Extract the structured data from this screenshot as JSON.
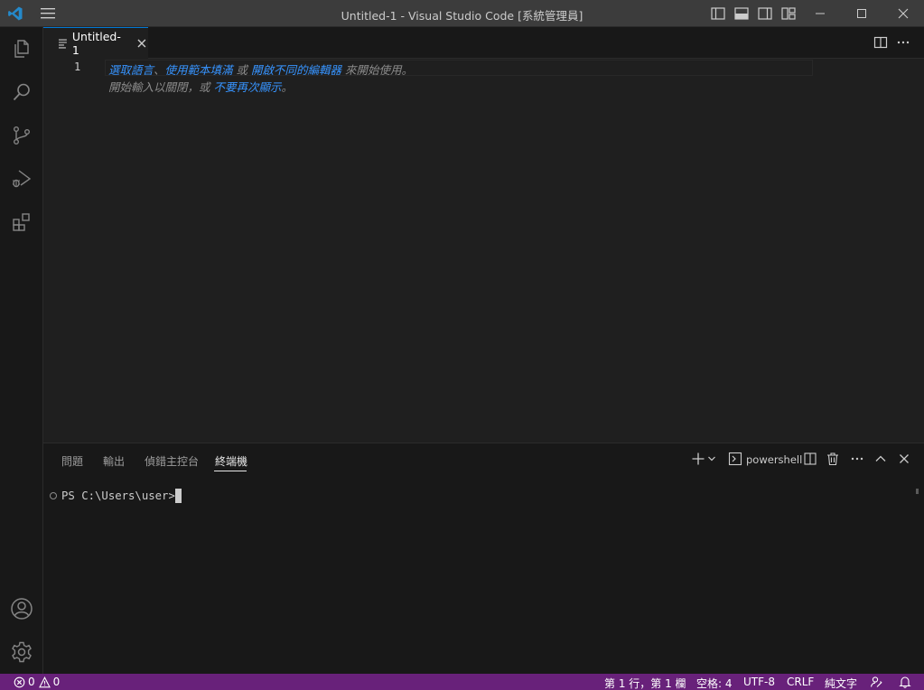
{
  "window": {
    "title": "Untitled-1 - Visual Studio Code [系統管理員]"
  },
  "titlebar": {
    "icons": [
      "vscode-logo-icon",
      "hamburger-menu-icon",
      "toggle-primary-sidebar-icon",
      "toggle-panel-icon",
      "toggle-secondary-sidebar-icon",
      "customize-layout-icon",
      "minimize-icon",
      "maximize-icon",
      "close-icon"
    ]
  },
  "activitybar": {
    "items": [
      "explorer-icon",
      "search-icon",
      "source-control-icon",
      "run-debug-icon",
      "extensions-icon"
    ],
    "bottom": [
      "accounts-icon",
      "manage-gear-icon"
    ]
  },
  "tabs": [
    {
      "label": "Untitled-1",
      "active": true
    }
  ],
  "editor": {
    "line_number": "1",
    "hint": {
      "link1": "選取語言",
      "sep1": "、",
      "link2": "使用範本填滿",
      "or": " 或 ",
      "link3": "開啟不同的編輯器",
      "tail": " 來開始使用。",
      "line2_text": "開始輸入以關閉，或 ",
      "link4": "不要再次顯示",
      "line2_tail": "。"
    }
  },
  "panel": {
    "tabs": [
      {
        "label": "問題",
        "active": false
      },
      {
        "label": "輸出",
        "active": false
      },
      {
        "label": "偵錯主控台",
        "active": false
      },
      {
        "label": "終端機",
        "active": true
      }
    ],
    "terminal_name": "powershell",
    "prompt": "PS C:\\Users\\user> "
  },
  "statusbar": {
    "errors": "0",
    "warnings": "0",
    "position": "第 1 行，第 1 欄",
    "indent": "空格: 4",
    "encoding": "UTF-8",
    "eol": "CRLF",
    "language": "純文字"
  },
  "colors": {
    "accent": "#0078d4",
    "status_bar": "#68217a",
    "link": "#3794ff"
  }
}
